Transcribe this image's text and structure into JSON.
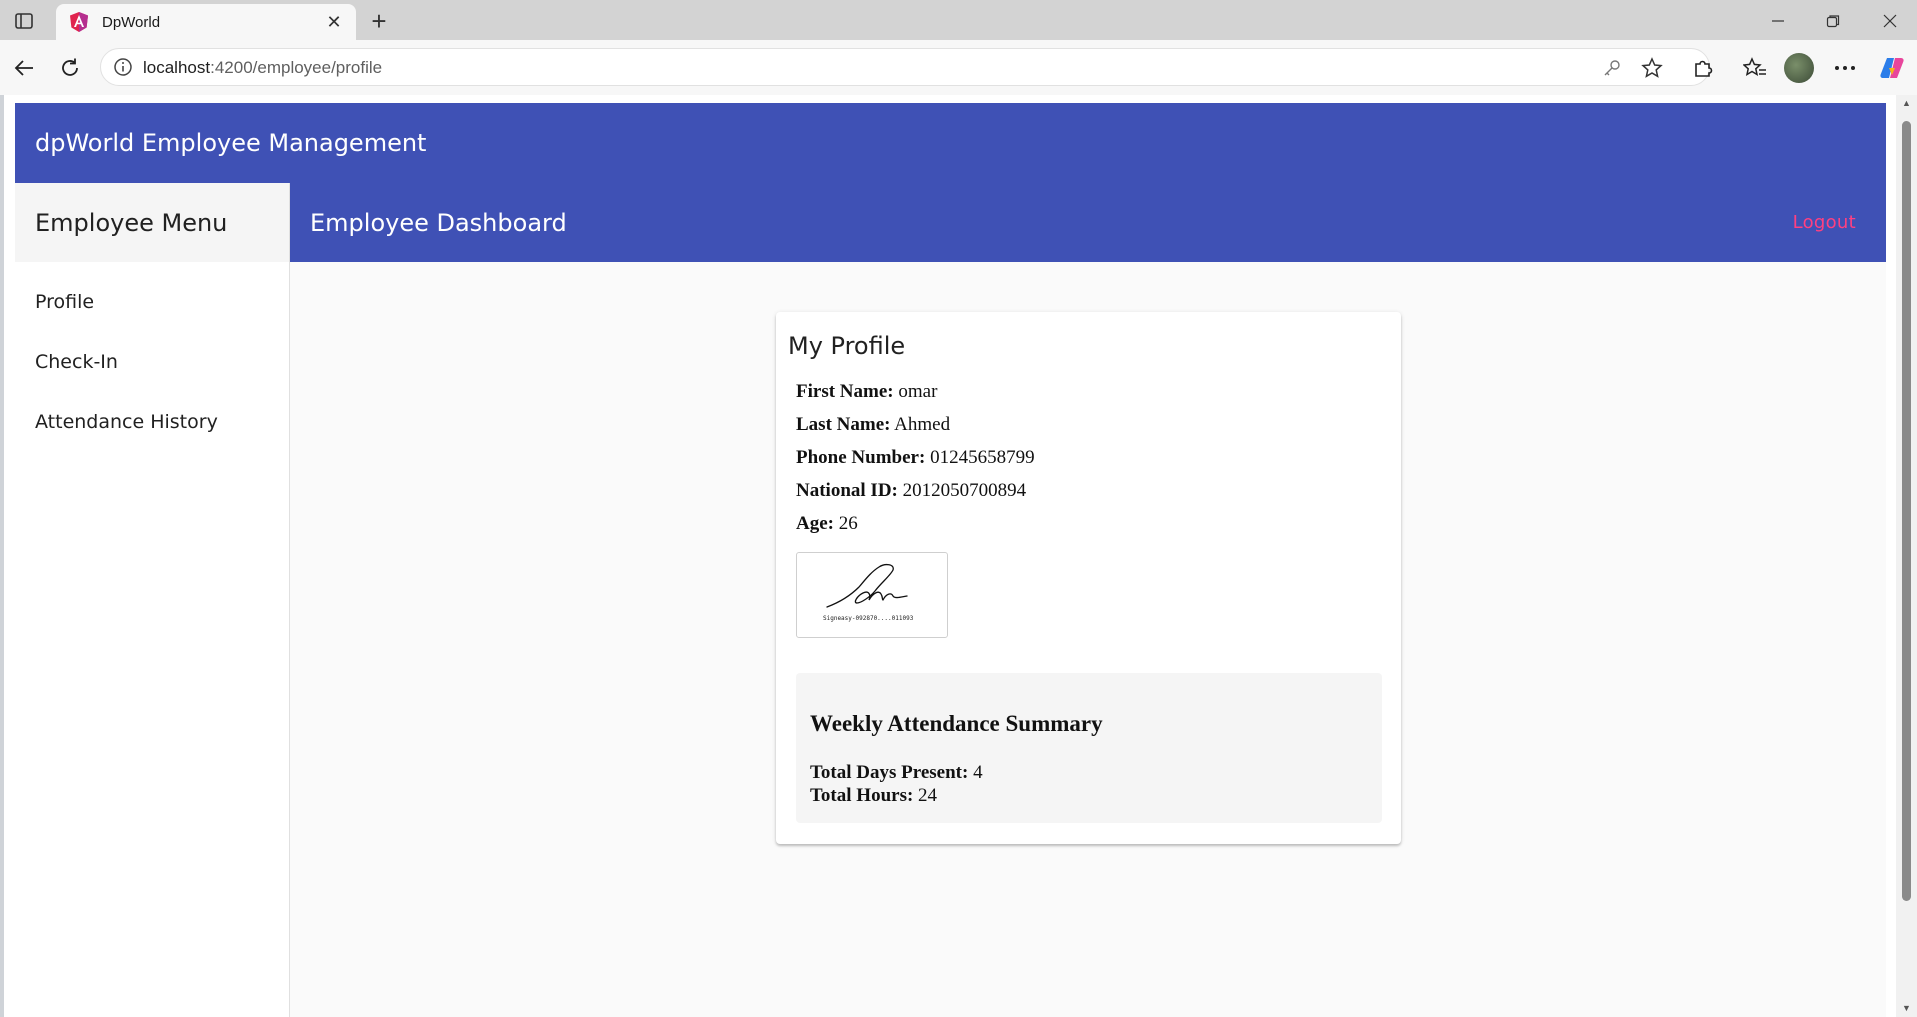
{
  "browser": {
    "tab_title": "DpWorld",
    "url_host": "localhost",
    "url_path": ":4200/employee/profile"
  },
  "app": {
    "title": "dpWorld Employee Management"
  },
  "sidenav": {
    "title": "Employee Menu",
    "items": [
      {
        "label": "Profile"
      },
      {
        "label": "Check-In"
      },
      {
        "label": "Attendance History"
      }
    ]
  },
  "content_bar": {
    "title": "Employee Dashboard",
    "logout_label": "Logout"
  },
  "profile": {
    "title": "My Profile",
    "fields": [
      {
        "label": "First Name:",
        "value": "omar"
      },
      {
        "label": "Last Name:",
        "value": "Ahmed"
      },
      {
        "label": "Phone Number:",
        "value": "01245658799"
      },
      {
        "label": "National ID:",
        "value": "2012050700894"
      },
      {
        "label": "Age:",
        "value": "26"
      }
    ],
    "signature_caption": "Signeasy-092870....011093"
  },
  "summary": {
    "title": "Weekly Attendance Summary",
    "days_label": "Total Days Present:",
    "days_value": "4",
    "hours_label": "Total Hours:",
    "hours_value": "24"
  },
  "colors": {
    "primary": "#3f51b5",
    "accent": "#ff4081"
  },
  "icons": {
    "tab_actions": "sidebar-toggle-icon",
    "favicon": "angular-icon",
    "close": "close-icon",
    "new_tab": "plus-icon",
    "back": "back-arrow-icon",
    "refresh": "refresh-icon",
    "info": "info-icon",
    "key": "key-icon",
    "favorite": "star-icon",
    "extensions": "puzzle-icon",
    "favorites_bar": "favorites-icon",
    "more": "more-icon",
    "copilot": "copilot-icon"
  }
}
